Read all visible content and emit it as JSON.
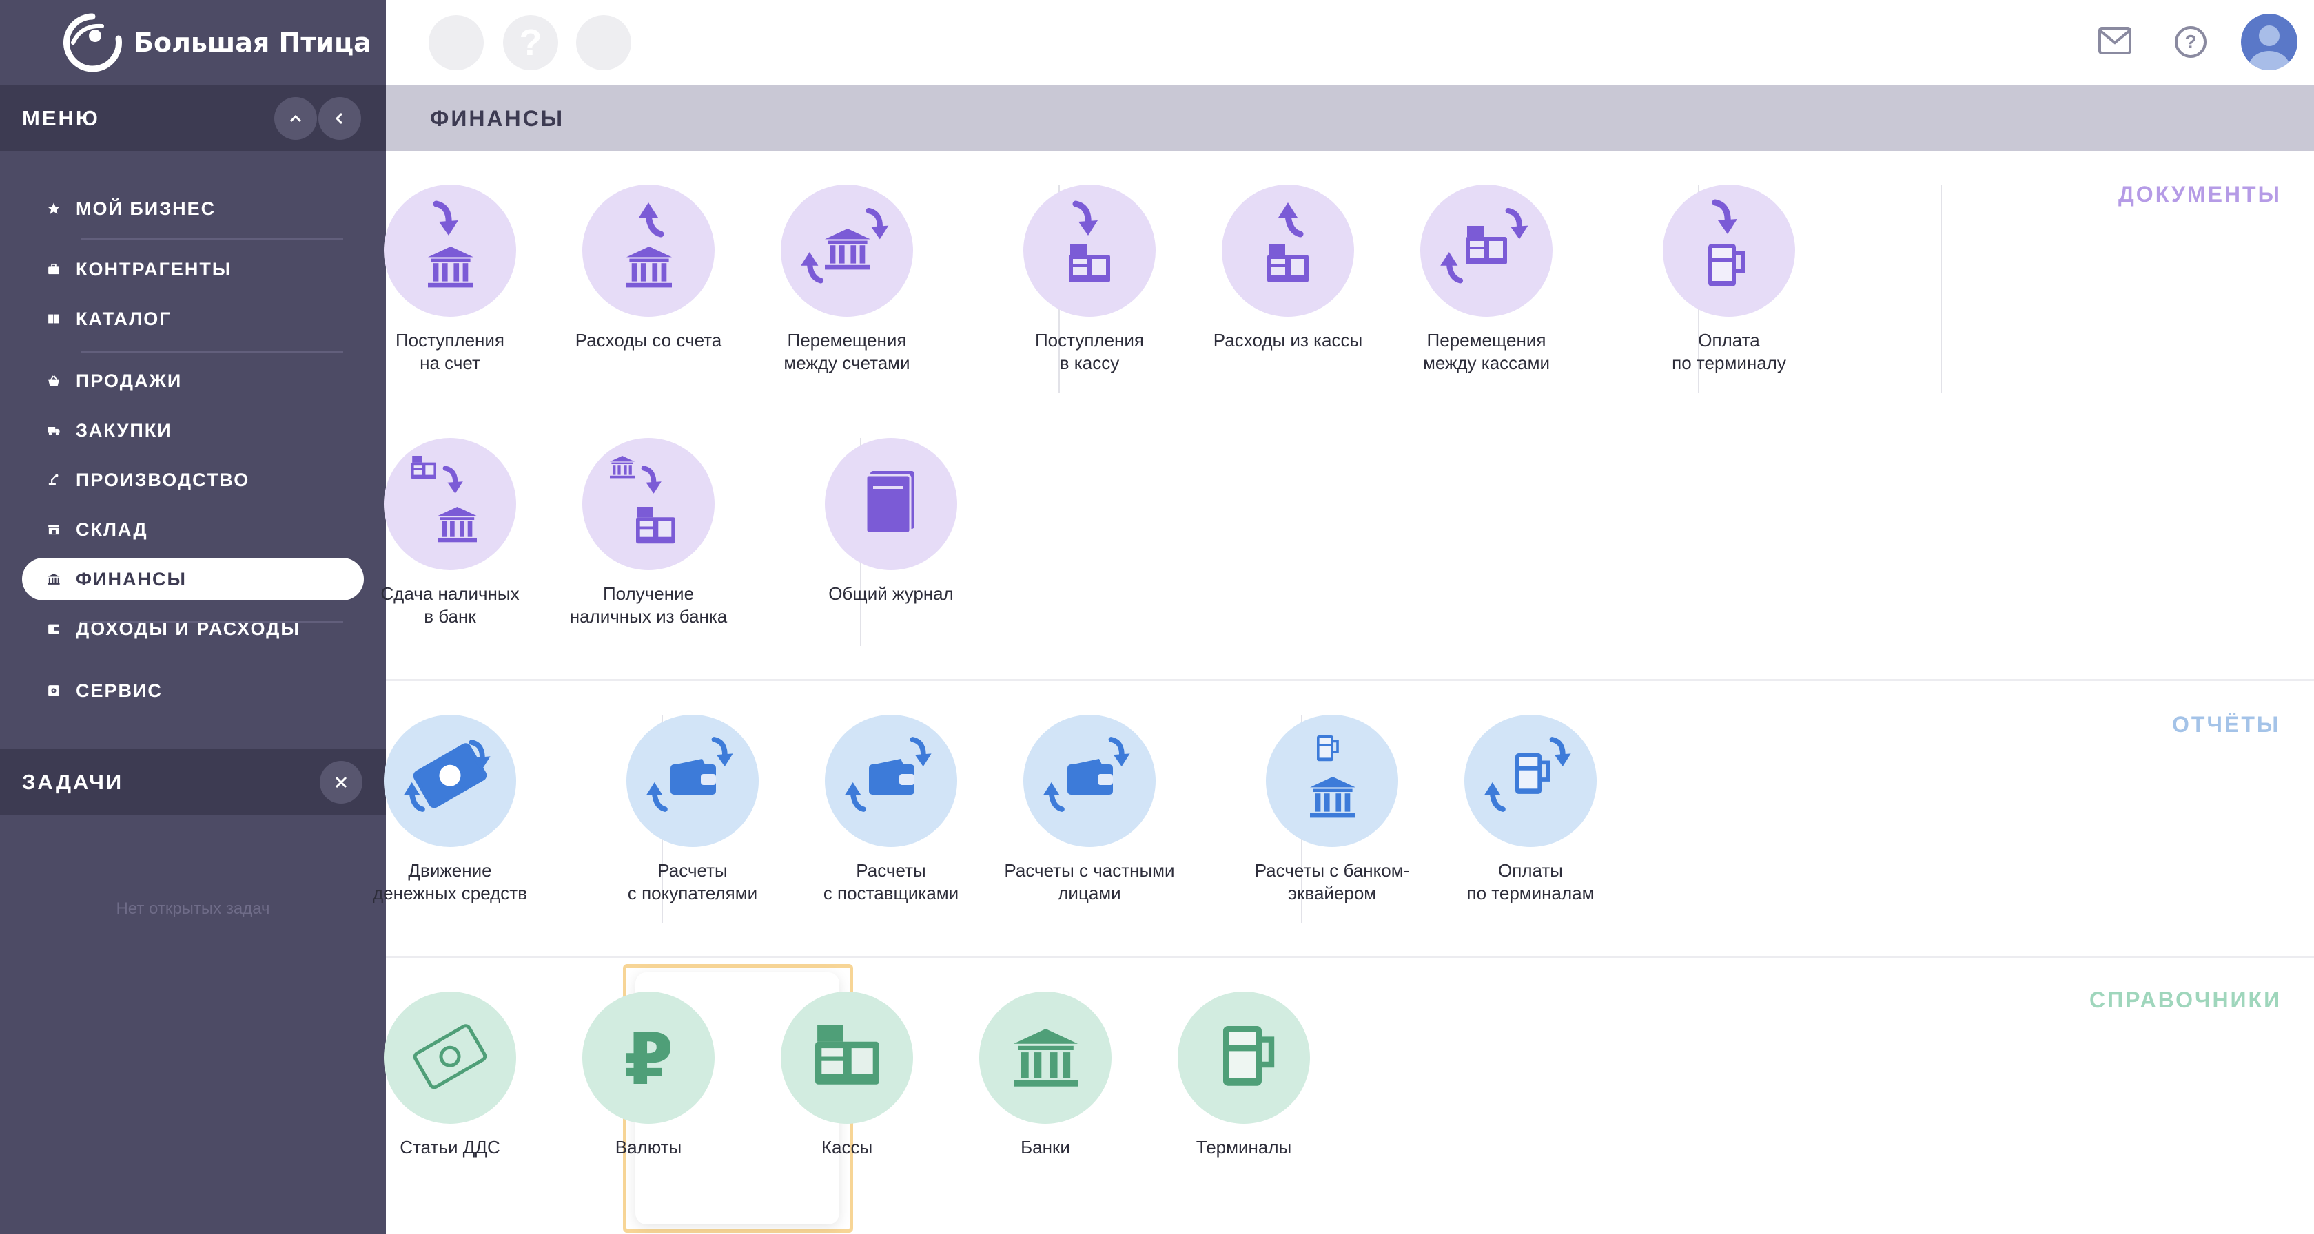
{
  "app": {
    "logo_text": "Большая Птица"
  },
  "sidebar": {
    "menu_title": "МЕНЮ",
    "items": [
      {
        "label": "МОЙ БИЗНЕС",
        "icon": "star-icon"
      },
      {
        "label": "КОНТРАГЕНТЫ",
        "icon": "briefcase-icon"
      },
      {
        "label": "КАТАЛОГ",
        "icon": "book-icon"
      },
      {
        "label": "ПРОДАЖИ",
        "icon": "basket-icon"
      },
      {
        "label": "ЗАКУПКИ",
        "icon": "truck-icon"
      },
      {
        "label": "ПРОИЗВОДСТВО",
        "icon": "robot-arm-icon"
      },
      {
        "label": "СКЛАД",
        "icon": "warehouse-icon"
      },
      {
        "label": "ФИНАНСЫ",
        "icon": "bank-icon",
        "active": true
      },
      {
        "label": "ДОХОДЫ И РАСХОДЫ",
        "icon": "wallet-icon"
      },
      {
        "label": "СЕРВИС",
        "icon": "gear-icon"
      }
    ],
    "tasks_title": "ЗАДАЧИ",
    "no_tasks": "Нет открытых задач"
  },
  "topbar": {
    "mail_icon": "mail-icon",
    "help_icon": "help-icon",
    "avatar": "avatar-icon"
  },
  "page": {
    "title": "ФИНАНСЫ"
  },
  "sections": {
    "documents": {
      "title": "ДОКУМЕНТЫ",
      "color": "#b59be6",
      "cards": [
        {
          "label": "Поступления\nна счет",
          "icon": "bank-deposit-icon"
        },
        {
          "label": "Расходы со счета",
          "icon": "bank-withdraw-icon"
        },
        {
          "label": "Перемещения\nмежду счетами",
          "icon": "bank-transfer-icon"
        },
        {
          "label": "Поступления\nв кассу",
          "icon": "register-deposit-icon"
        },
        {
          "label": "Расходы из кассы",
          "icon": "register-withdraw-icon"
        },
        {
          "label": "Перемещения\nмежду кассами",
          "icon": "register-transfer-icon"
        },
        {
          "label": "Оплата\nпо терминалу",
          "icon": "terminal-payment-icon"
        },
        {
          "label": "Сдача наличных\nв банк",
          "icon": "cash-to-bank-icon"
        },
        {
          "label": "Получение\nналичных из банка",
          "icon": "cash-from-bank-icon"
        },
        {
          "label": "Общий журнал",
          "icon": "journal-icon"
        }
      ]
    },
    "reports": {
      "title": "ОТЧЁТЫ",
      "color": "#a4c3e8",
      "cards": [
        {
          "label": "Движение\nденежных средств",
          "icon": "cash-flow-icon"
        },
        {
          "label": "Расчеты\nс покупателями",
          "icon": "customers-settlement-icon"
        },
        {
          "label": "Расчеты\nс поставщиками",
          "icon": "suppliers-settlement-icon"
        },
        {
          "label": "Расчеты с частными\nлицами",
          "icon": "individuals-settlement-icon"
        },
        {
          "label": "Расчеты с банком-\nэквайером",
          "icon": "acquirer-settlement-icon"
        },
        {
          "label": "Оплаты\nпо терминалам",
          "icon": "terminal-payments-icon"
        }
      ]
    },
    "references": {
      "title": "СПРАВОЧНИКИ",
      "color": "#9fd6bc",
      "cards": [
        {
          "label": "Статьи ДДС",
          "icon": "cash-items-icon"
        },
        {
          "label": "Валюты",
          "icon": "ruble-icon"
        },
        {
          "label": "Кассы",
          "icon": "cash-register-icon"
        },
        {
          "label": "Банки",
          "icon": "bank-building-icon"
        },
        {
          "label": "Терминалы",
          "icon": "pos-terminal-icon"
        }
      ]
    }
  },
  "colors": {
    "purple": "#7b5bd6",
    "blue": "#3d7bd9",
    "green": "#4f9f78"
  }
}
